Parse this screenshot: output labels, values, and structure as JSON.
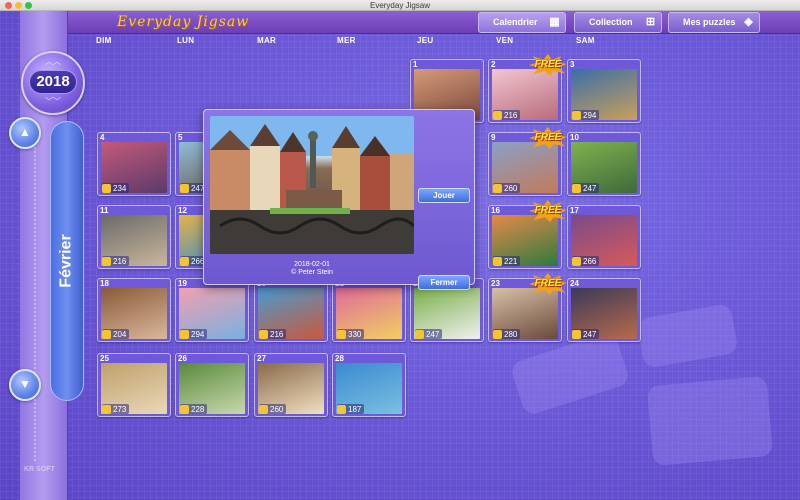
{
  "window": {
    "title": "Everyday Jigsaw"
  },
  "header": {
    "logo": "Everyday Jigsaw",
    "nav": [
      {
        "label": "Calendrier",
        "icon": "calendar-icon"
      },
      {
        "label": "Collection",
        "icon": "cart-icon"
      },
      {
        "label": "Mes puzzles",
        "icon": "puzzle-box-icon"
      }
    ]
  },
  "weekdays": [
    "DIM",
    "LUN",
    "MAR",
    "MER",
    "JEU",
    "VEN",
    "SAM"
  ],
  "sidebar": {
    "year": "2018",
    "month": "Février",
    "brand": "KR SOFT"
  },
  "free_label": "FREE",
  "days": [
    {
      "day": "1",
      "pieces": ""
    },
    {
      "day": "2",
      "pieces": "216",
      "free": true
    },
    {
      "day": "3",
      "pieces": "294"
    },
    {
      "day": "4",
      "pieces": "234"
    },
    {
      "day": "5",
      "pieces": "247"
    },
    {
      "day": "9",
      "pieces": "260",
      "free": true
    },
    {
      "day": "10",
      "pieces": "247"
    },
    {
      "day": "11",
      "pieces": "216"
    },
    {
      "day": "12",
      "pieces": "266"
    },
    {
      "day": "16",
      "pieces": "221",
      "free": true
    },
    {
      "day": "17",
      "pieces": "266"
    },
    {
      "day": "18",
      "pieces": "204"
    },
    {
      "day": "19",
      "pieces": "294"
    },
    {
      "day": "20",
      "pieces": "216"
    },
    {
      "day": "21",
      "pieces": "330"
    },
    {
      "day": "22",
      "pieces": "247"
    },
    {
      "day": "23",
      "pieces": "280",
      "free": true
    },
    {
      "day": "24",
      "pieces": "247"
    },
    {
      "day": "25",
      "pieces": "273"
    },
    {
      "day": "26",
      "pieces": "228"
    },
    {
      "day": "27",
      "pieces": "260"
    },
    {
      "day": "28",
      "pieces": "187"
    }
  ],
  "popup": {
    "date": "2018-02-01",
    "credit": "© Peter Stein",
    "play_label": "Jouer",
    "close_label": "Fermer"
  }
}
